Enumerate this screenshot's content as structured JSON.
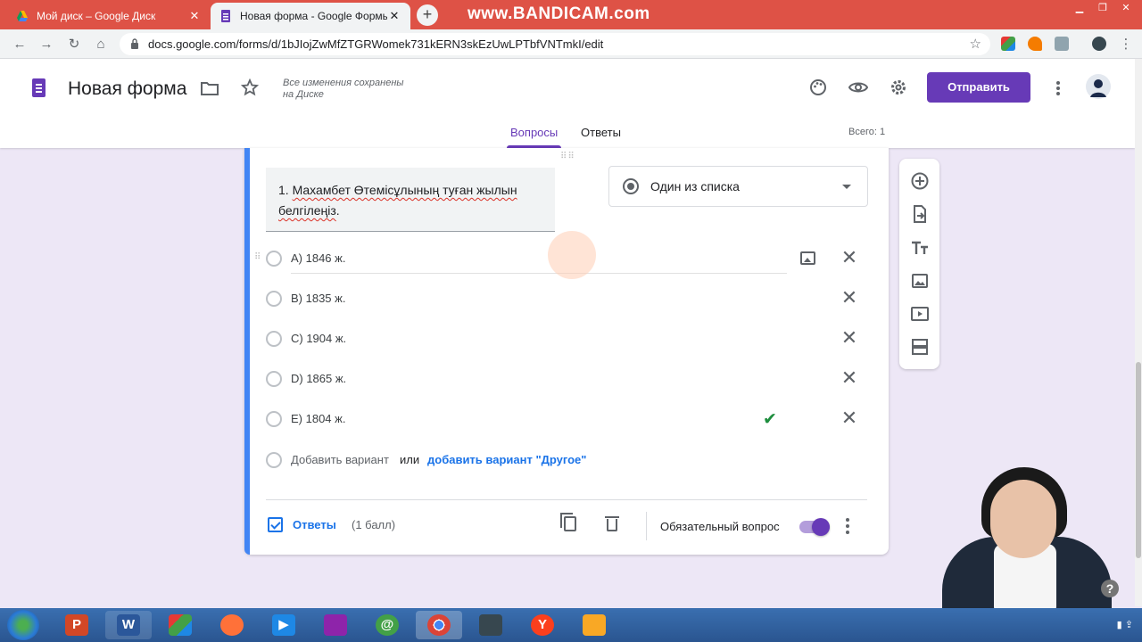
{
  "browser": {
    "tabs": [
      {
        "label": "Мой диск – Google Диск",
        "active": false
      },
      {
        "label": "Новая форма - Google Формы",
        "active": true
      }
    ],
    "watermark": "www.BANDICAM.com",
    "url": "docs.google.com/forms/d/1bJIojZwMfZTGRWomek731kERN3skEzUwLPTbfVNTmkI/edit"
  },
  "header": {
    "title": "Новая форма",
    "saved_line1": "Все изменения сохранены",
    "saved_line2": "на Диске",
    "send_label": "Отправить",
    "tabs": [
      "Вопросы",
      "Ответы"
    ],
    "total": "Всего: 1"
  },
  "question": {
    "line1_prefix": "1. ",
    "line1_words": "Махамбет Өтемісұлының туған жылын",
    "line2": "белгілеңіз",
    "line2_suffix": ".",
    "type_label": "Один из списка",
    "options": [
      {
        "label": "А) 1846 ж.",
        "correct": false
      },
      {
        "label": "В) 1835 ж.",
        "correct": false
      },
      {
        "label": "С) 1904 ж.",
        "correct": false
      },
      {
        "label": "D) 1865 ж.",
        "correct": false
      },
      {
        "label": "Е) 1804 ж.",
        "correct": true
      }
    ],
    "add_option": "Добавить вариант",
    "or_label": "или",
    "add_other": "добавить вариант \"Другое\"",
    "answers_label": "Ответы",
    "points": "(1 балл)",
    "required_label": "Обязательный вопрос",
    "required": true
  },
  "side_tools": [
    "add-question-icon",
    "import-questions-icon",
    "add-title-icon",
    "add-image-icon",
    "add-video-icon",
    "add-section-icon"
  ],
  "colors": {
    "accent": "#673ab7",
    "card_bar": "#4285f4",
    "link": "#1a73e8",
    "tabbar": "#de5246"
  }
}
